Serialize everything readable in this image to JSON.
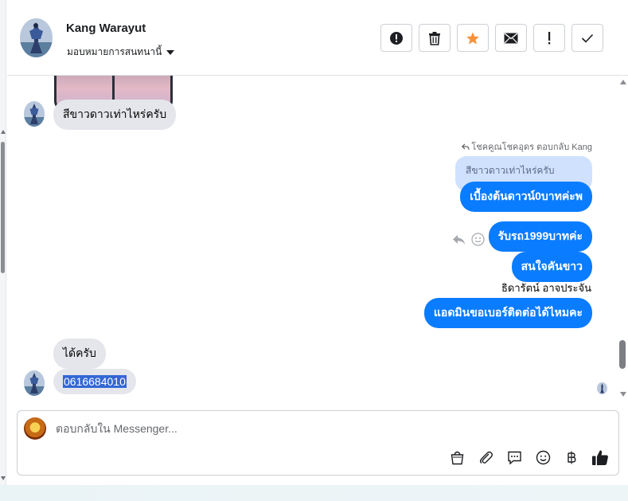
{
  "header": {
    "name": "Kang Warayut",
    "assign_label": "มอบหมายการสนทนานี้"
  },
  "toolbar": [
    {
      "icon": "alert-circle-icon",
      "name": "mark-spam-button"
    },
    {
      "icon": "trash-icon",
      "name": "delete-button"
    },
    {
      "icon": "star-icon",
      "name": "star-button",
      "color": "#f7923a"
    },
    {
      "icon": "envelope-icon",
      "name": "mark-unread-button"
    },
    {
      "icon": "exclamation-icon",
      "name": "follow-up-button"
    },
    {
      "icon": "check-icon",
      "name": "mark-done-button"
    }
  ],
  "messages": {
    "in_1": "สีขาวดาวเท่าไหร่ครับ",
    "reply_meta": "โชคคูณโชคอุดร ตอบกลับ Kang",
    "quoted": "สีขาวดาวเท่าไหร่ครับ",
    "out_1": "เบื้องต้นดาวน์0บาทค่ะพ",
    "out_2": "รับรถ1999บาทค่ะ",
    "out_3": "สนใจคันขาว",
    "sender_label": "ธิดารัตน์ อาจประจัน",
    "out_4": "แอดมินขอเบอร์ติดต่อได้ไหมคะ",
    "in_2": "ได้ครับ",
    "in_3": "0616684010"
  },
  "composer": {
    "placeholder": "ตอบกลับใน Messenger..."
  },
  "colors": {
    "outgoing_bubble": "#0a7cff",
    "incoming_bubble": "#e4e6eb",
    "quoted_bubble": "#cfe1fd",
    "selection": "#3367d6"
  }
}
